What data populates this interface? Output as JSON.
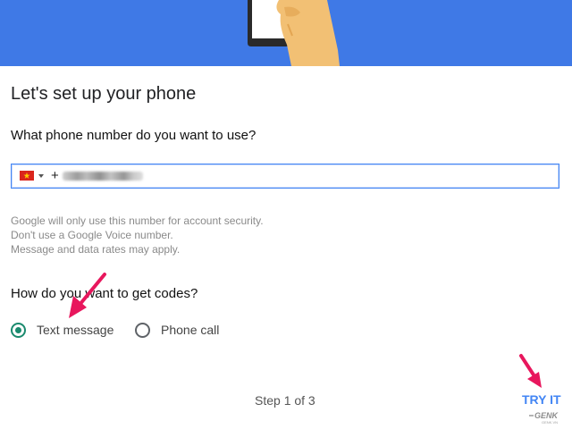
{
  "page": {
    "title": "Let's set up your phone"
  },
  "phone": {
    "question": "What phone number do you want to use?",
    "country_flag": "vietnam-flag",
    "value_prefix": "+",
    "notes": [
      "Google will only use this number for account security.",
      "Don't use a Google Voice number.",
      "Message and data rates may apply."
    ]
  },
  "codes": {
    "question": "How do you want to get codes?",
    "options": [
      {
        "label": "Text message",
        "selected": true
      },
      {
        "label": "Phone call",
        "selected": false
      }
    ]
  },
  "footer": {
    "step": "Step 1 of 3",
    "action": "TRY IT"
  },
  "colors": {
    "header_blue": "#3f79e6",
    "accent_blue": "#4285f4",
    "radio_green": "#1a8a6e",
    "annotation_pink": "#e8175d"
  },
  "watermark": {
    "text": "GENK"
  }
}
